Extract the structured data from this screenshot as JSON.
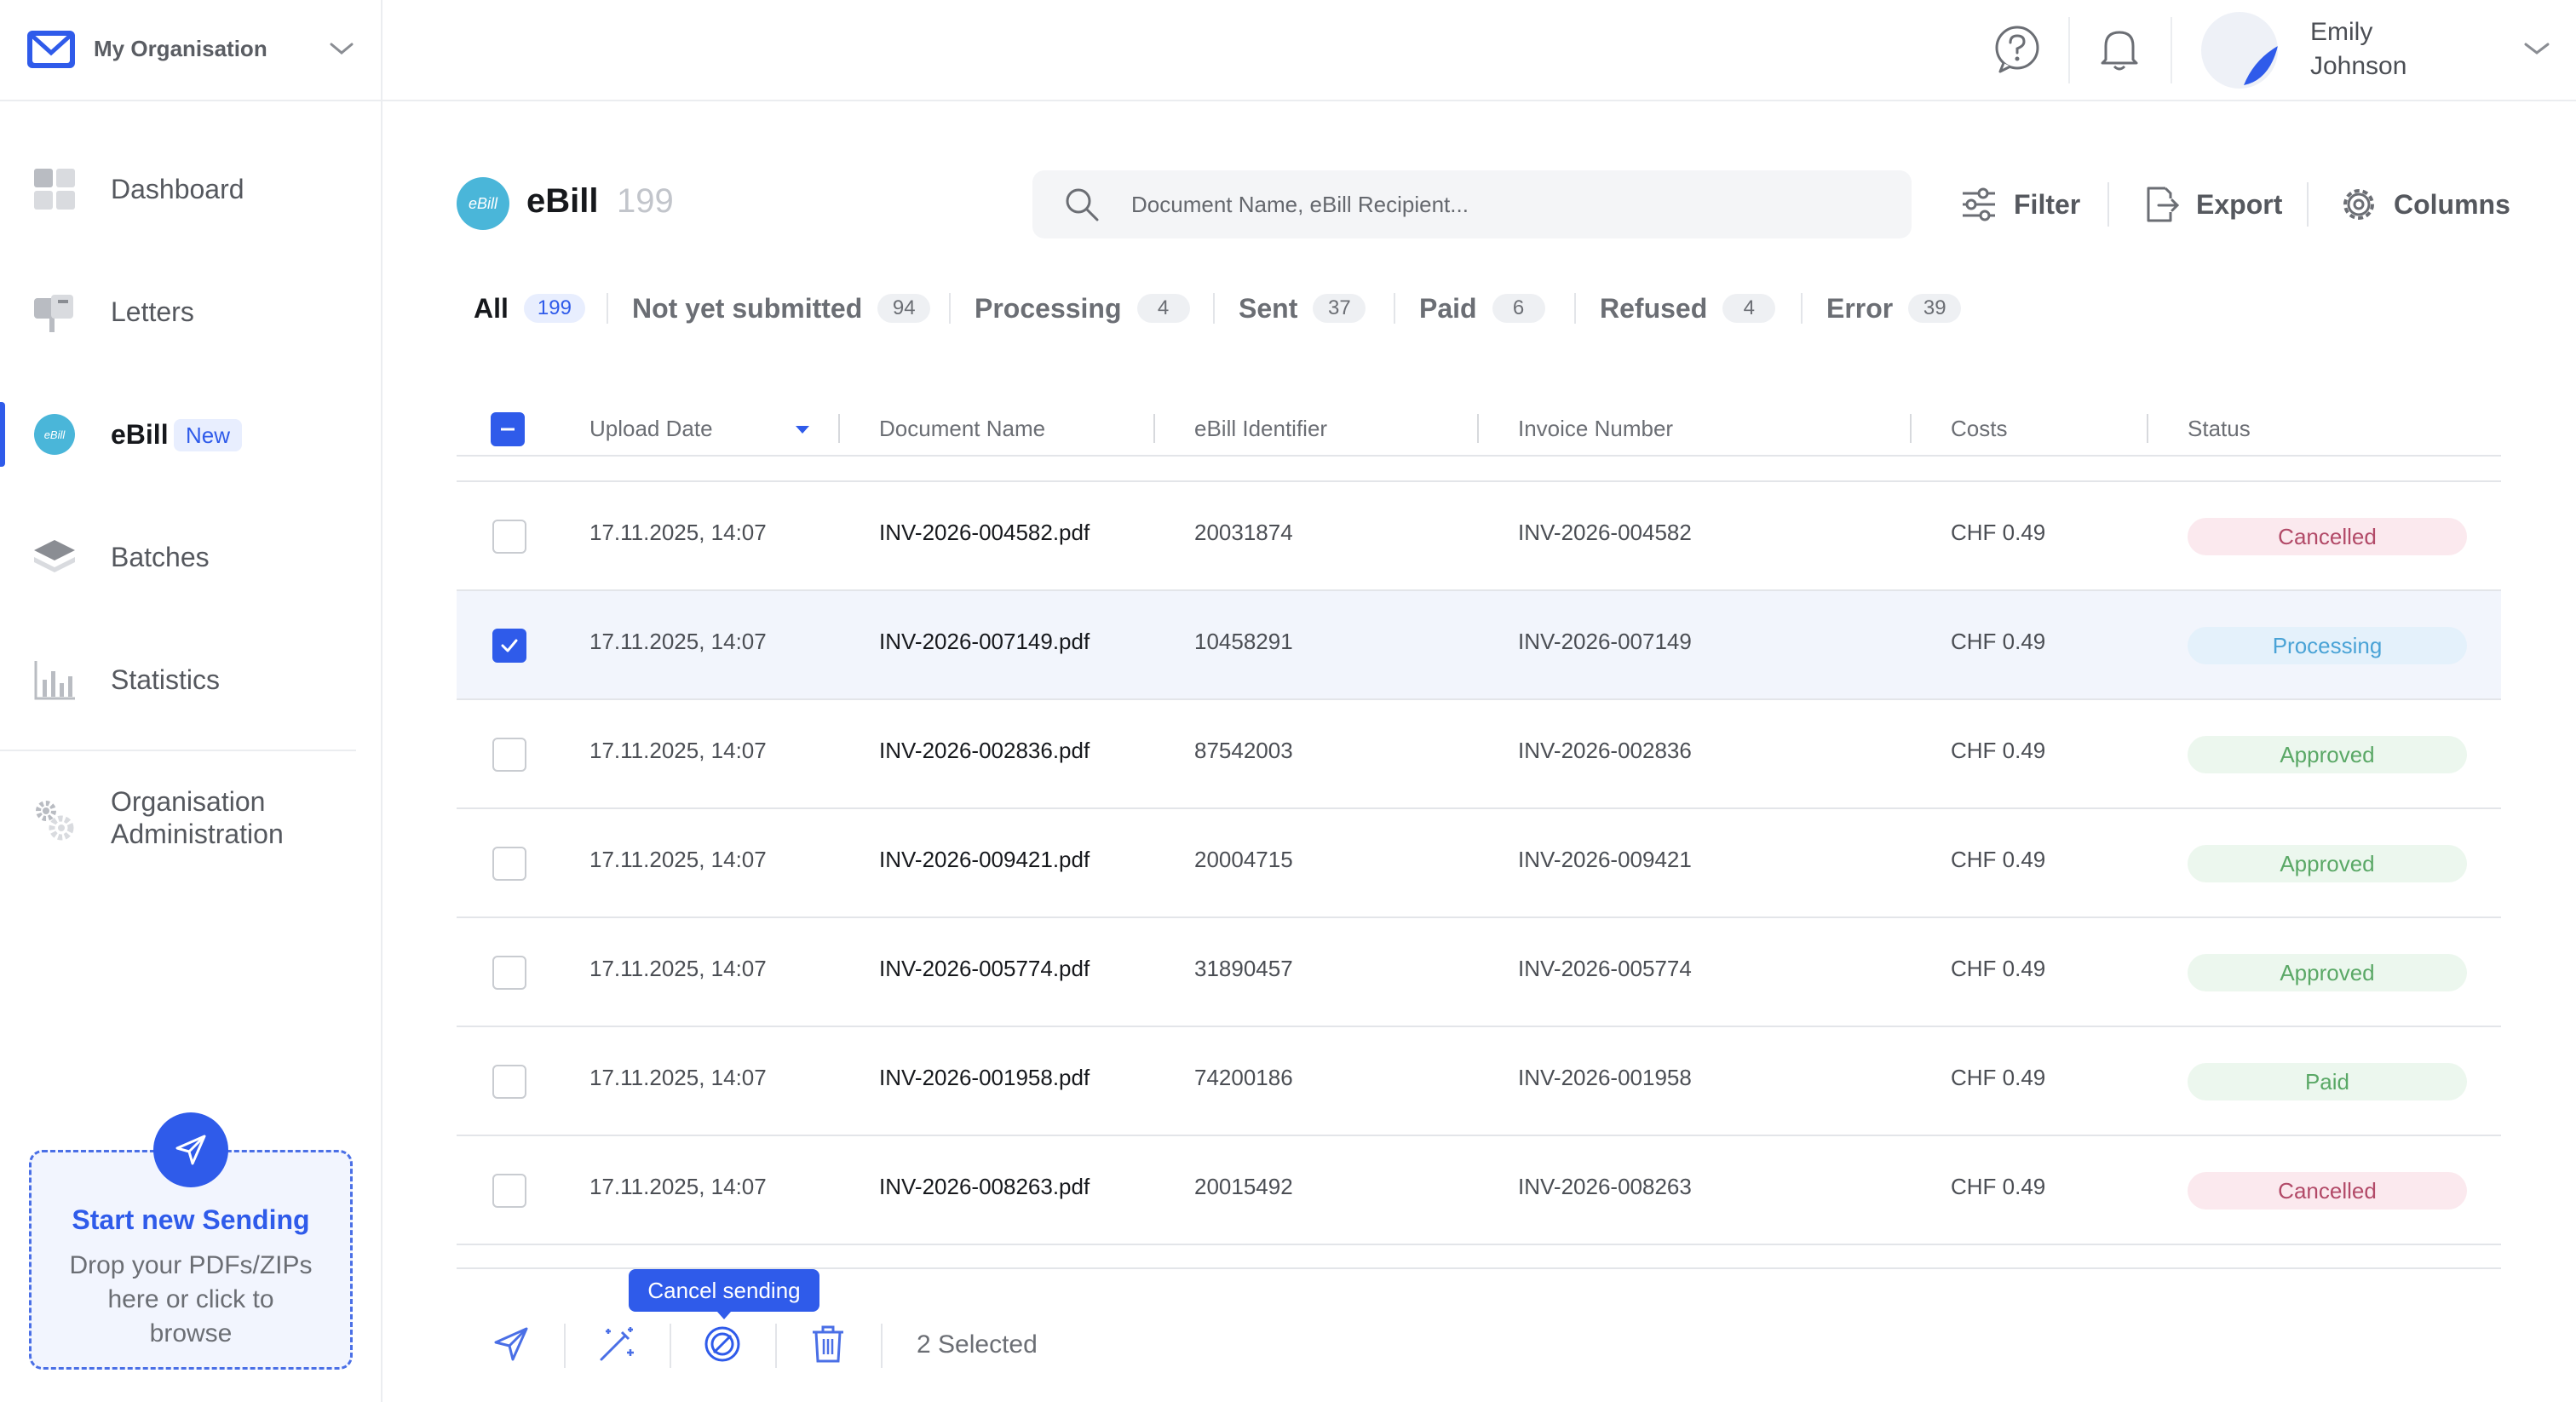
{
  "org": {
    "name": "My Organisation"
  },
  "user": {
    "first": "Emily",
    "last": "Johnson"
  },
  "nav": {
    "items": [
      {
        "label": "Dashboard",
        "icon": "dashboard-icon"
      },
      {
        "label": "Letters",
        "icon": "mailbox-icon"
      },
      {
        "label": "eBill",
        "icon": "ebill-icon",
        "badge": "New"
      },
      {
        "label": "Batches",
        "icon": "layers-icon"
      },
      {
        "label": "Statistics",
        "icon": "bar-chart-icon"
      }
    ],
    "admin_label": "Organisation Administration"
  },
  "dropzone": {
    "title": "Start new Sending",
    "subtitle": "Drop your PDFs/ZIPs here or click to browse"
  },
  "page": {
    "logo_text": "eBill",
    "title": "eBill",
    "count": "199"
  },
  "search": {
    "placeholder": "Document Name, eBill Recipient..."
  },
  "toolbar": {
    "filter": "Filter",
    "export": "Export",
    "columns": "Columns"
  },
  "tabs": [
    {
      "label": "All",
      "count": "199"
    },
    {
      "label": "Not yet submitted",
      "count": "94"
    },
    {
      "label": "Processing",
      "count": "4"
    },
    {
      "label": "Sent",
      "count": "37"
    },
    {
      "label": "Paid",
      "count": "6"
    },
    {
      "label": "Refused",
      "count": "4"
    },
    {
      "label": "Error",
      "count": "39"
    }
  ],
  "table": {
    "columns": [
      "Upload Date",
      "Document Name",
      "eBill Identifier",
      "Invoice Number",
      "Costs",
      "Status"
    ],
    "rows": [
      {
        "date": "17.11.2025, 14:07",
        "doc": "INV-2026-004582.pdf",
        "id": "20031874",
        "invoice": "INV-2026-004582",
        "cost": "CHF 0.49",
        "status": "Cancelled"
      },
      {
        "date": "17.11.2025, 14:07",
        "doc": "INV-2026-007149.pdf",
        "id": "10458291",
        "invoice": "INV-2026-007149",
        "cost": "CHF 0.49",
        "status": "Processing"
      },
      {
        "date": "17.11.2025, 14:07",
        "doc": "INV-2026-002836.pdf",
        "id": "87542003",
        "invoice": "INV-2026-002836",
        "cost": "CHF 0.49",
        "status": "Approved"
      },
      {
        "date": "17.11.2025, 14:07",
        "doc": "INV-2026-009421.pdf",
        "id": "20004715",
        "invoice": "INV-2026-009421",
        "cost": "CHF 0.49",
        "status": "Approved"
      },
      {
        "date": "17.11.2025, 14:07",
        "doc": "INV-2026-005774.pdf",
        "id": "31890457",
        "invoice": "INV-2026-005774",
        "cost": "CHF 0.49",
        "status": "Approved"
      },
      {
        "date": "17.11.2025, 14:07",
        "doc": "INV-2026-001958.pdf",
        "id": "74200186",
        "invoice": "INV-2026-001958",
        "cost": "CHF 0.49",
        "status": "Paid"
      },
      {
        "date": "17.11.2025, 14:07",
        "doc": "INV-2026-008263.pdf",
        "id": "20015492",
        "invoice": "INV-2026-008263",
        "cost": "CHF 0.49",
        "status": "Cancelled"
      }
    ]
  },
  "status_colors": {
    "Cancelled": {
      "bg": "#fbe9ee",
      "fg": "#b24a68"
    },
    "Processing": {
      "bg": "#e4f1fb",
      "fg": "#4aa3d6"
    },
    "Approved": {
      "bg": "#ecf7ee",
      "fg": "#5aa866"
    },
    "Paid": {
      "bg": "#ecf7ee",
      "fg": "#5aa866"
    }
  },
  "bulk": {
    "selected": "2 Selected",
    "tooltip": "Cancel sending"
  },
  "colors": {
    "accent": "#2f5bea",
    "ebill": "#4ab6d9"
  }
}
